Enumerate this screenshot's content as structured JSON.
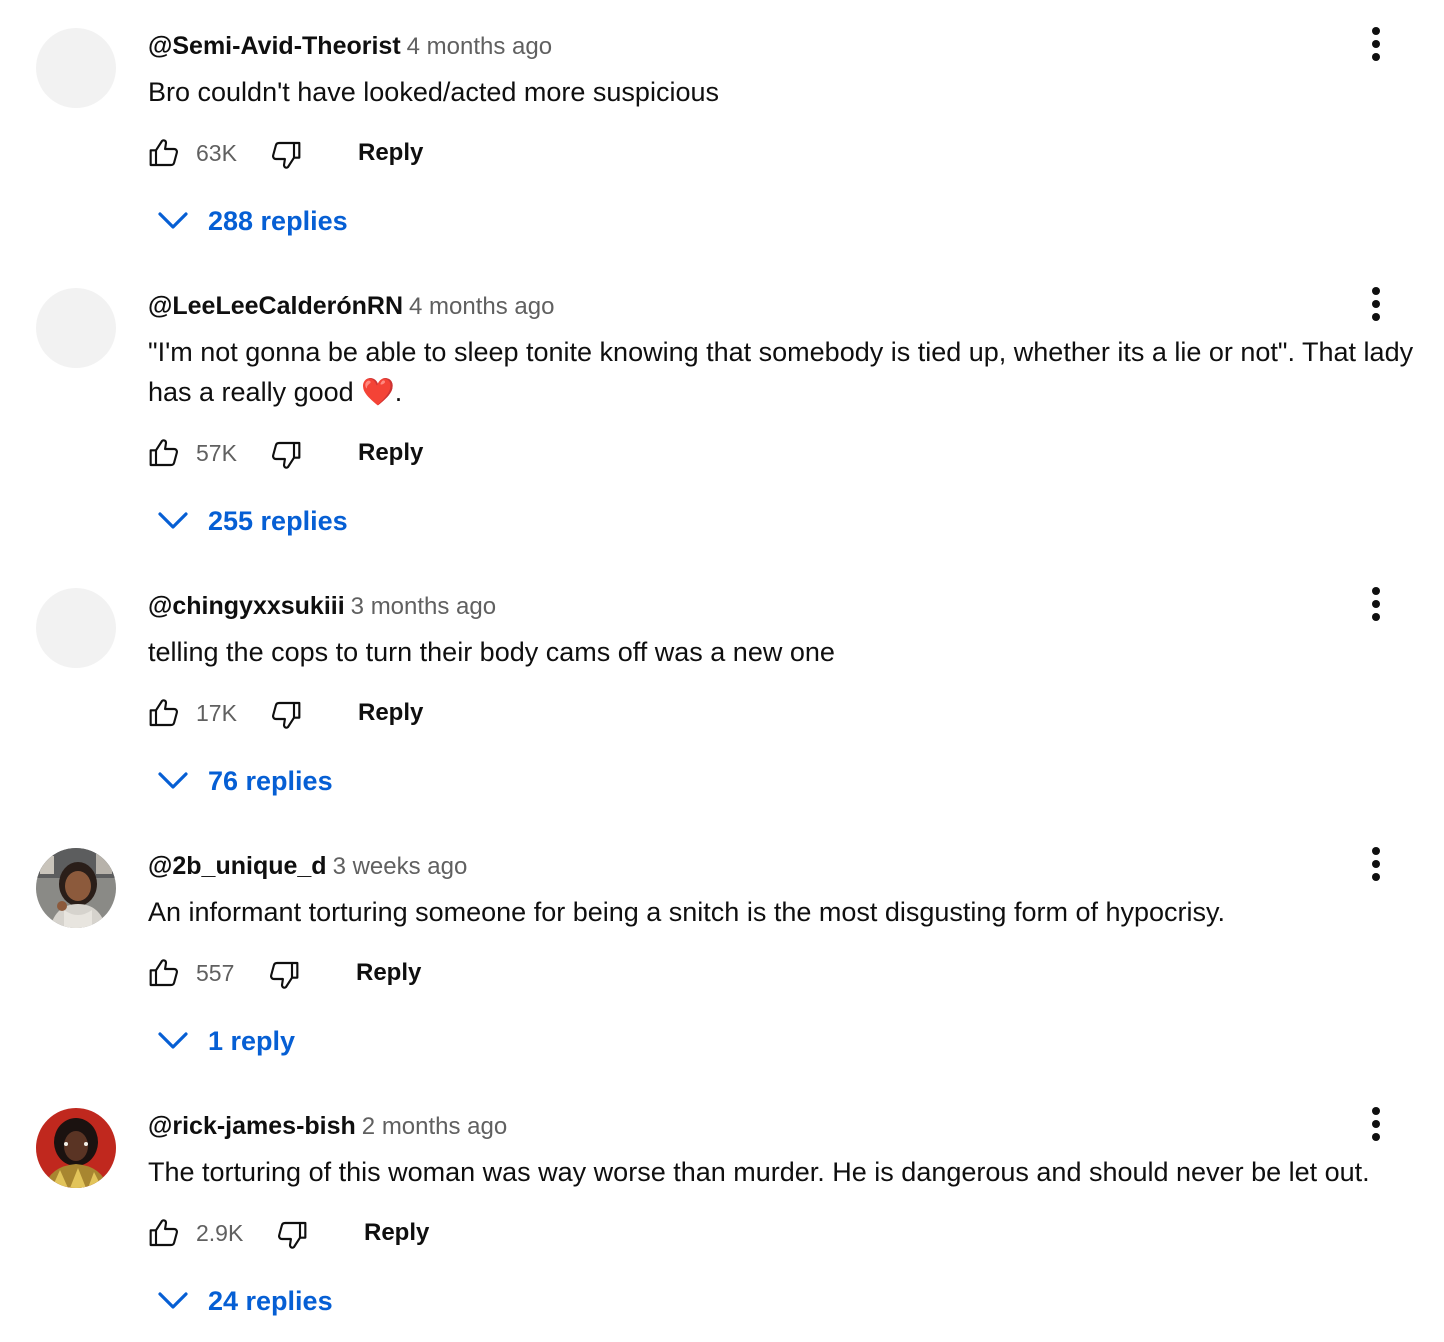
{
  "comments": [
    {
      "author": "@Semi-Avid-Theorist",
      "time": "4 months ago",
      "text": "Bro couldn't have looked/acted more suspicious",
      "likes": "63K",
      "reply_label": "Reply",
      "replies_label": "288 replies",
      "avatar": "blank-avatar"
    },
    {
      "author": "@LeeLeeCalderónRN",
      "time": "4 months ago",
      "text": "\"I'm not gonna be able to sleep tonite knowing that somebody is tied up, whether its a lie or not\". That lady has a really good",
      "text_suffix": ".",
      "emoji": "❤️",
      "likes": "57K",
      "reply_label": "Reply",
      "replies_label": "255 replies",
      "avatar": "blank-avatar"
    },
    {
      "author": "@chingyxxsukiii",
      "time": "3 months ago",
      "text": "telling the cops to turn their body cams off was a new one",
      "likes": "17K",
      "reply_label": "Reply",
      "replies_label": "76 replies",
      "avatar": "blank-avatar"
    },
    {
      "author": "@2b_unique_d",
      "time": "3 weeks ago",
      "text": "An informant torturing someone for being a snitch is the most disgusting form of hypocrisy.",
      "likes": "557",
      "reply_label": "Reply",
      "replies_label": "1 reply",
      "avatar": "photo-avatar-woman"
    },
    {
      "author": "@rick-james-bish",
      "time": "2 months ago",
      "text": "The torturing of this woman was way worse than murder. He is dangerous and should never be let out.",
      "likes": "2.9K",
      "reply_label": "Reply",
      "replies_label": "24 replies",
      "avatar": "photo-avatar-red"
    }
  ],
  "icons": {
    "like": "thumbs-up-icon",
    "dislike": "thumbs-down-icon",
    "expand": "chevron-down-icon",
    "menu": "more-vert-icon"
  },
  "colors": {
    "link_blue": "#065fd4",
    "text": "#0f0f0f",
    "secondary": "#606060",
    "avatar_placeholder": "#f2f2f2"
  }
}
